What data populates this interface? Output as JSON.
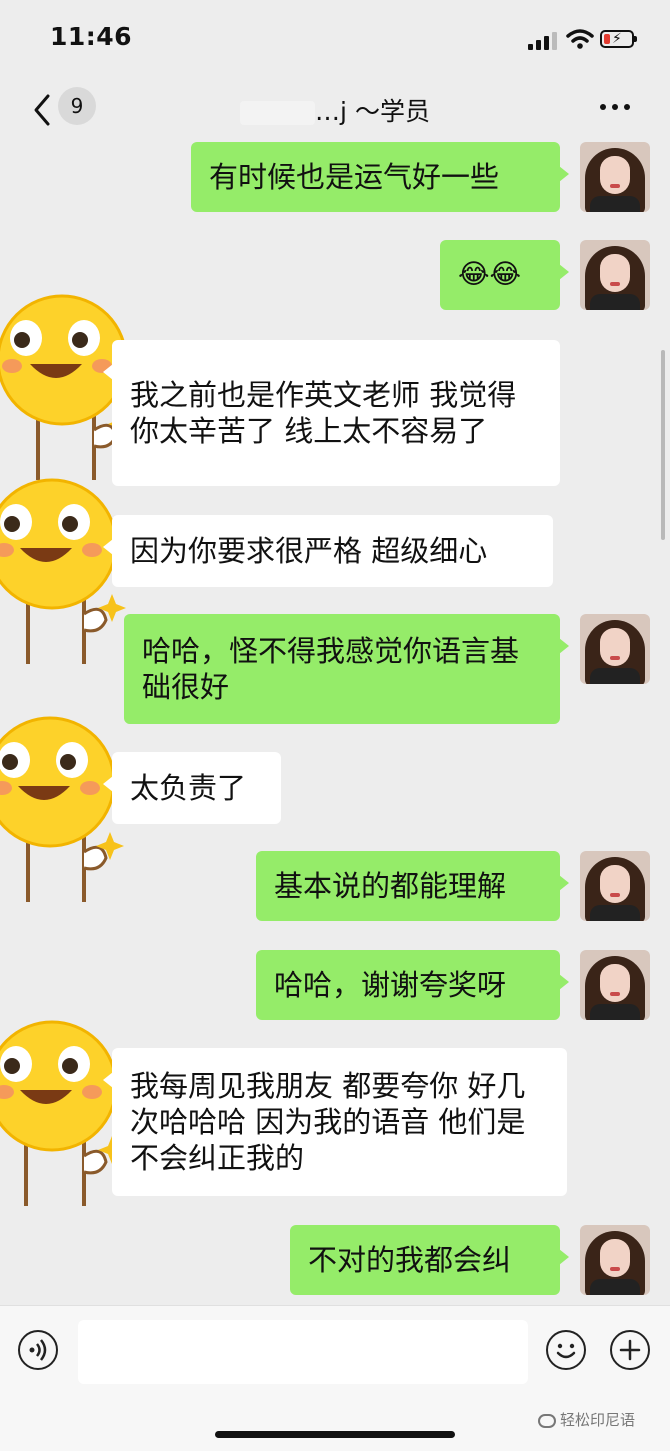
{
  "status": {
    "time": "11:46"
  },
  "nav": {
    "unread_count": "9",
    "title_suffix": "…j ～学员"
  },
  "messages": [
    {
      "side": "sent",
      "text": "有时候也是运气好一些"
    },
    {
      "side": "sent",
      "text": "😂😂"
    },
    {
      "side": "recv",
      "text": "我之前也是作英文老师 我觉得 你太辛苦了 线上太不容易了"
    },
    {
      "side": "recv",
      "text": "因为你要求很严格 超级细心"
    },
    {
      "side": "sent",
      "text": "哈哈，怪不得我感觉你语言基础很好"
    },
    {
      "side": "recv",
      "text": "太负责了"
    },
    {
      "side": "sent",
      "text": "基本说的都能理解"
    },
    {
      "side": "sent",
      "text": "哈哈，谢谢夸奖呀"
    },
    {
      "side": "recv",
      "text": " 我每周见我朋友 都要夸你 好几次哈哈哈 因为我的语音 他们是不会纠正我的"
    },
    {
      "side": "sent",
      "text": "不对的我都会纠"
    }
  ],
  "input": {
    "placeholder": ""
  },
  "watermark": "轻松印尼语",
  "colors": {
    "sent_bubble": "#95ec69",
    "recv_bubble": "#ffffff",
    "background": "#ededed"
  },
  "icons": [
    "chevron-left-icon",
    "more-icon",
    "voice-icon",
    "emoji-icon",
    "plus-icon"
  ]
}
